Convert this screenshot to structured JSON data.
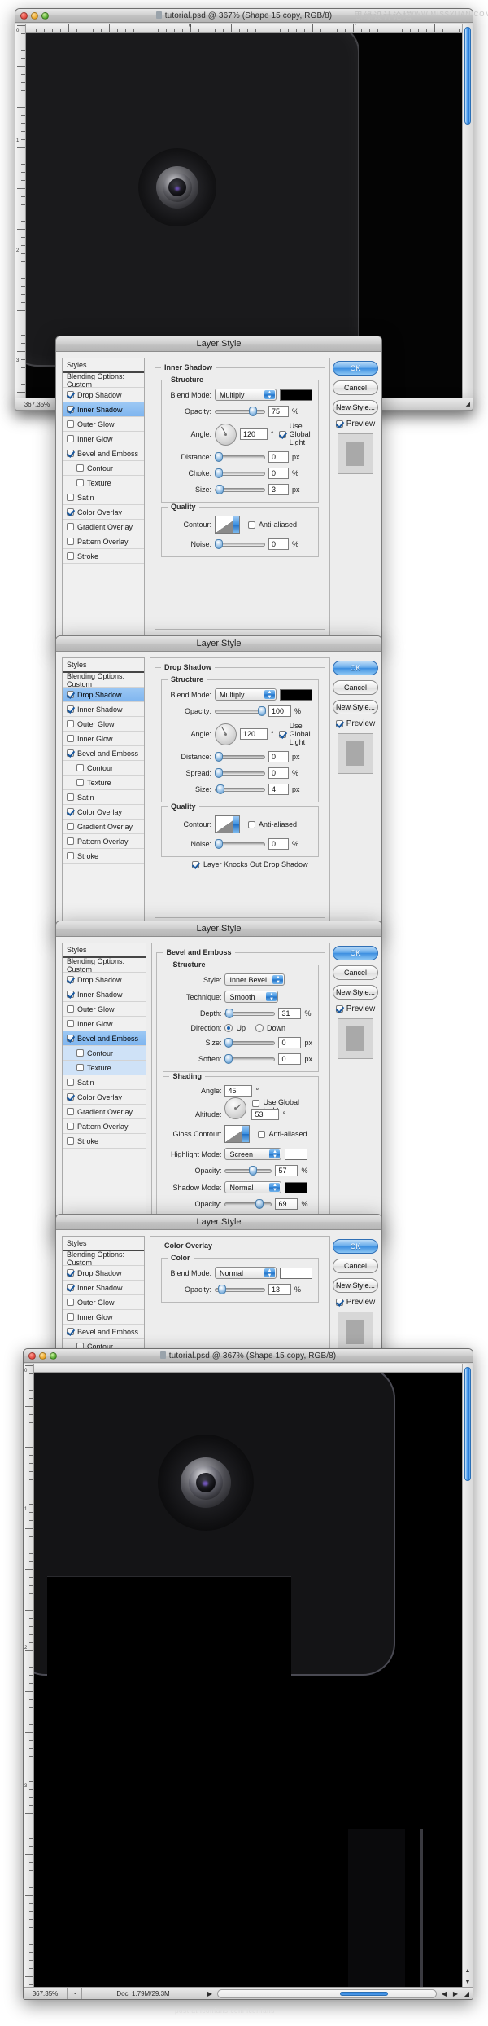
{
  "app": {
    "watermark_top_cn": "思缘设计论坛",
    "watermark_top_en": "WWW.MISSYUAN.COM",
    "watermark_bottom": "post at iconfans.com  iconfans"
  },
  "window_top": {
    "title": "tutorial.psd @ 367% (Shape 15 copy, RGB/8)",
    "ruler_marks": [
      "6",
      "7"
    ],
    "ruler_v_marks": [
      "0",
      "1",
      "2",
      "3"
    ],
    "status": {
      "zoom": "367.35%",
      "doc": ""
    }
  },
  "window_bottom": {
    "title": "tutorial.psd @ 367% (Shape 15 copy, RGB/8)",
    "ruler_v_marks": [
      "0",
      "1",
      "2",
      "3"
    ],
    "status": {
      "zoom": "367.35%",
      "doc": "Doc: 1.79M/29.3M"
    }
  },
  "dialog_common": {
    "window_title": "Layer Style",
    "styles_header": "Styles",
    "blending_options": "Blending Options: Custom",
    "buttons": {
      "ok": "OK",
      "cancel": "Cancel",
      "new_style": "New Style...",
      "preview": "Preview"
    },
    "styles_list": [
      {
        "label": "Drop Shadow",
        "checked": true,
        "sub": false
      },
      {
        "label": "Inner Shadow",
        "checked": true,
        "sub": false
      },
      {
        "label": "Outer Glow",
        "checked": false,
        "sub": false
      },
      {
        "label": "Inner Glow",
        "checked": false,
        "sub": false
      },
      {
        "label": "Bevel and Emboss",
        "checked": true,
        "sub": false
      },
      {
        "label": "Contour",
        "checked": false,
        "sub": true
      },
      {
        "label": "Texture",
        "checked": false,
        "sub": true
      },
      {
        "label": "Satin",
        "checked": false,
        "sub": false
      },
      {
        "label": "Color Overlay",
        "checked": true,
        "sub": false
      },
      {
        "label": "Gradient Overlay",
        "checked": false,
        "sub": false
      },
      {
        "label": "Pattern Overlay",
        "checked": false,
        "sub": false
      },
      {
        "label": "Stroke",
        "checked": false,
        "sub": false
      }
    ]
  },
  "dialog_inner_shadow": {
    "selected_style": "Inner Shadow",
    "panel_title": "Inner Shadow",
    "structure_label": "Structure",
    "quality_label": "Quality",
    "blend_mode_label": "Blend Mode:",
    "blend_mode_value": "Multiply",
    "blend_color": "#000000",
    "opacity_label": "Opacity:",
    "opacity_value": "75",
    "opacity_unit": "%",
    "angle_label": "Angle:",
    "angle_value": "120",
    "angle_unit": "°",
    "use_global_light": "Use Global Light",
    "use_global_light_checked": true,
    "distance_label": "Distance:",
    "distance_value": "0",
    "distance_unit": "px",
    "choke_label": "Choke:",
    "choke_value": "0",
    "choke_unit": "%",
    "size_label": "Size:",
    "size_value": "3",
    "size_unit": "px",
    "contour_label": "Contour:",
    "anti_aliased": "Anti-aliased",
    "anti_aliased_checked": false,
    "noise_label": "Noise:",
    "noise_value": "0",
    "noise_unit": "%"
  },
  "dialog_drop_shadow": {
    "selected_style": "Drop Shadow",
    "panel_title": "Drop Shadow",
    "structure_label": "Structure",
    "quality_label": "Quality",
    "blend_mode_label": "Blend Mode:",
    "blend_mode_value": "Multiply",
    "blend_color": "#000000",
    "opacity_label": "Opacity:",
    "opacity_value": "100",
    "opacity_unit": "%",
    "angle_label": "Angle:",
    "angle_value": "120",
    "angle_unit": "°",
    "use_global_light": "Use Global Light",
    "use_global_light_checked": true,
    "distance_label": "Distance:",
    "distance_value": "0",
    "distance_unit": "px",
    "spread_label": "Spread:",
    "spread_value": "0",
    "spread_unit": "%",
    "size_label": "Size:",
    "size_value": "4",
    "size_unit": "px",
    "contour_label": "Contour:",
    "anti_aliased": "Anti-aliased",
    "anti_aliased_checked": false,
    "noise_label": "Noise:",
    "noise_value": "0",
    "noise_unit": "%",
    "knockout_label": "Layer Knocks Out Drop Shadow",
    "knockout_checked": true
  },
  "dialog_bevel": {
    "selected_style": "Bevel and Emboss",
    "panel_title": "Bevel and Emboss",
    "structure_label": "Structure",
    "shading_label": "Shading",
    "style_label": "Style:",
    "style_value": "Inner Bevel",
    "technique_label": "Technique:",
    "technique_value": "Smooth",
    "depth_label": "Depth:",
    "depth_value": "31",
    "depth_unit": "%",
    "direction_label": "Direction:",
    "direction_up": "Up",
    "direction_down": "Down",
    "direction_selected": "Up",
    "size_label": "Size:",
    "size_value": "0",
    "size_unit": "px",
    "soften_label": "Soften:",
    "soften_value": "0",
    "soften_unit": "px",
    "angle_label": "Angle:",
    "angle_value": "45",
    "angle_unit": "°",
    "use_global_light": "Use Global Light",
    "use_global_light_checked": false,
    "altitude_label": "Altitude:",
    "altitude_value": "53",
    "altitude_unit": "°",
    "gloss_contour_label": "Gloss Contour:",
    "anti_aliased": "Anti-aliased",
    "anti_aliased_checked": false,
    "highlight_mode_label": "Highlight Mode:",
    "highlight_mode_value": "Screen",
    "highlight_color": "#ffffff",
    "highlight_opacity_label": "Opacity:",
    "highlight_opacity_value": "57",
    "highlight_opacity_unit": "%",
    "shadow_mode_label": "Shadow Mode:",
    "shadow_mode_value": "Normal",
    "shadow_color": "#000000",
    "shadow_opacity_label": "Opacity:",
    "shadow_opacity_value": "69",
    "shadow_opacity_unit": "%"
  },
  "dialog_color_overlay": {
    "selected_style": "Color Overlay",
    "panel_title": "Color Overlay",
    "color_label": "Color",
    "blend_mode_label": "Blend Mode:",
    "blend_mode_value": "Normal",
    "blend_color": "#ffffff",
    "opacity_label": "Opacity:",
    "opacity_value": "13",
    "opacity_unit": "%"
  }
}
